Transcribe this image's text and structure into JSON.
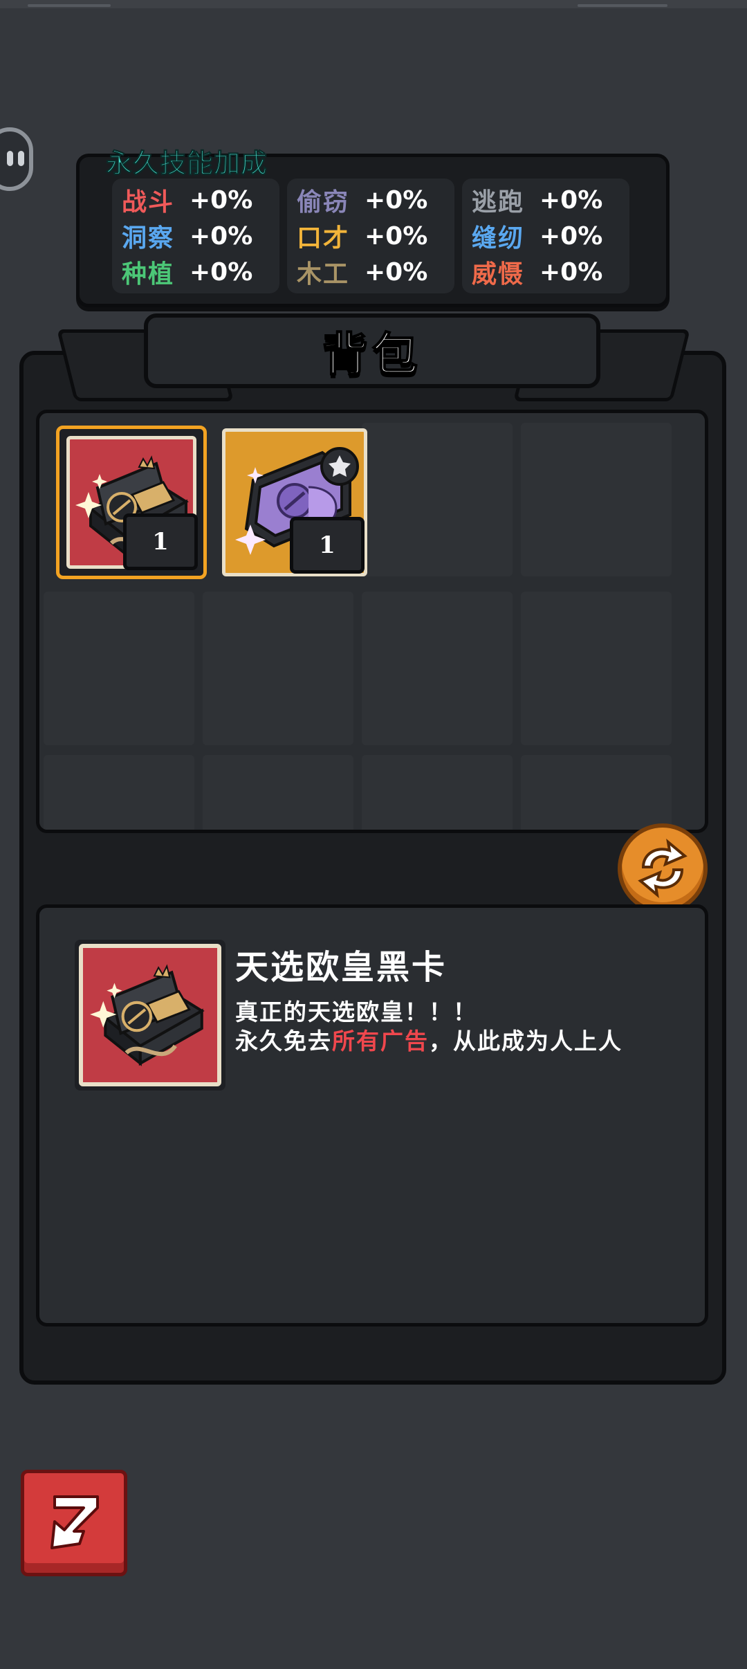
{
  "bonus": {
    "title": "永久技能加成",
    "skills": [
      {
        "name": "战斗",
        "value": "+0%",
        "color": "#f05a5a"
      },
      {
        "name": "洞察",
        "value": "+0%",
        "color": "#5aa8f0"
      },
      {
        "name": "种植",
        "value": "+0%",
        "color": "#4cc777"
      },
      {
        "name": "偷窃",
        "value": "+0%",
        "color": "#8a86b8"
      },
      {
        "name": "口才",
        "value": "+0%",
        "color": "#f2b43a"
      },
      {
        "name": "木工",
        "value": "+0%",
        "color": "#a99466"
      },
      {
        "name": "逃跑",
        "value": "+0%",
        "color": "#9aa0a8"
      },
      {
        "name": "缝纫",
        "value": "+0%",
        "color": "#5aa8f0"
      },
      {
        "name": "威慑",
        "value": "+0%",
        "color": "#ef6a4a"
      }
    ]
  },
  "backpack": {
    "title": "背包",
    "items": [
      {
        "icon": "black-card-gift-box-icon",
        "count": "1",
        "selected": true
      },
      {
        "icon": "purple-card-package-icon",
        "count": "1",
        "selected": false
      }
    ]
  },
  "detail": {
    "name": "天选欧皇黑卡",
    "line1": "真正的天选欧皇！！！",
    "line2_pre": "永久免去",
    "line2_highlight": "所有广告",
    "line2_post": "，从此成为人上人"
  },
  "colors": {
    "accent_orange": "#f3a322",
    "highlight_red": "#f0474d",
    "title_teal": "#46e0cf"
  }
}
